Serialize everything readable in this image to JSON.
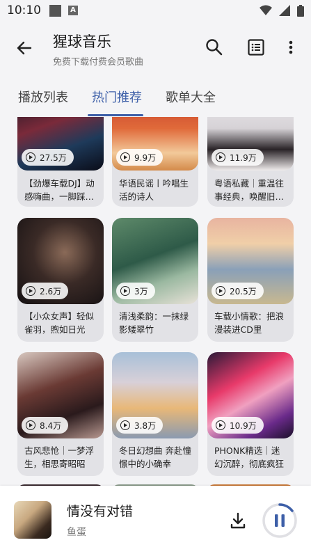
{
  "status": {
    "time": "10:10"
  },
  "header": {
    "title": "猩球音乐",
    "subtitle": "免费下载付费会员歌曲"
  },
  "tabs": [
    {
      "label": "播放列表"
    },
    {
      "label": "热门推荐"
    },
    {
      "label": "歌单大全"
    }
  ],
  "active_tab": "热门推荐",
  "playlists": [
    {
      "plays": "27.5万",
      "title": "【劲爆车载DJ】动感嗨曲，一脚踩…"
    },
    {
      "plays": "9.9万",
      "title": "华语民谣丨吟唱生活的诗人"
    },
    {
      "plays": "11.9万",
      "title": "粤语私藏｜重温往事经典，唤醒旧…"
    },
    {
      "plays": "2.6万",
      "title": "【小众女声】轻似雀羽，煦如日光"
    },
    {
      "plays": "3万",
      "title": "清浅柔韵：一抹绿影矮翠竹"
    },
    {
      "plays": "20.5万",
      "title": "车载小情歌：把浪漫装进CD里"
    },
    {
      "plays": "8.4万",
      "title": "古风悲怆｜一梦浮生，相思寄昭昭"
    },
    {
      "plays": "3.8万",
      "title": "冬日幻想曲 奔赴憧憬中的小确幸"
    },
    {
      "plays": "10.9万",
      "title": "PHONK精选｜迷幻沉醉，彻底疯狂"
    }
  ],
  "player": {
    "song": "情没有对错",
    "artist": "鱼蛋"
  },
  "colors": {
    "accent": "#3d5fa8",
    "background": "#f4f4f6"
  }
}
